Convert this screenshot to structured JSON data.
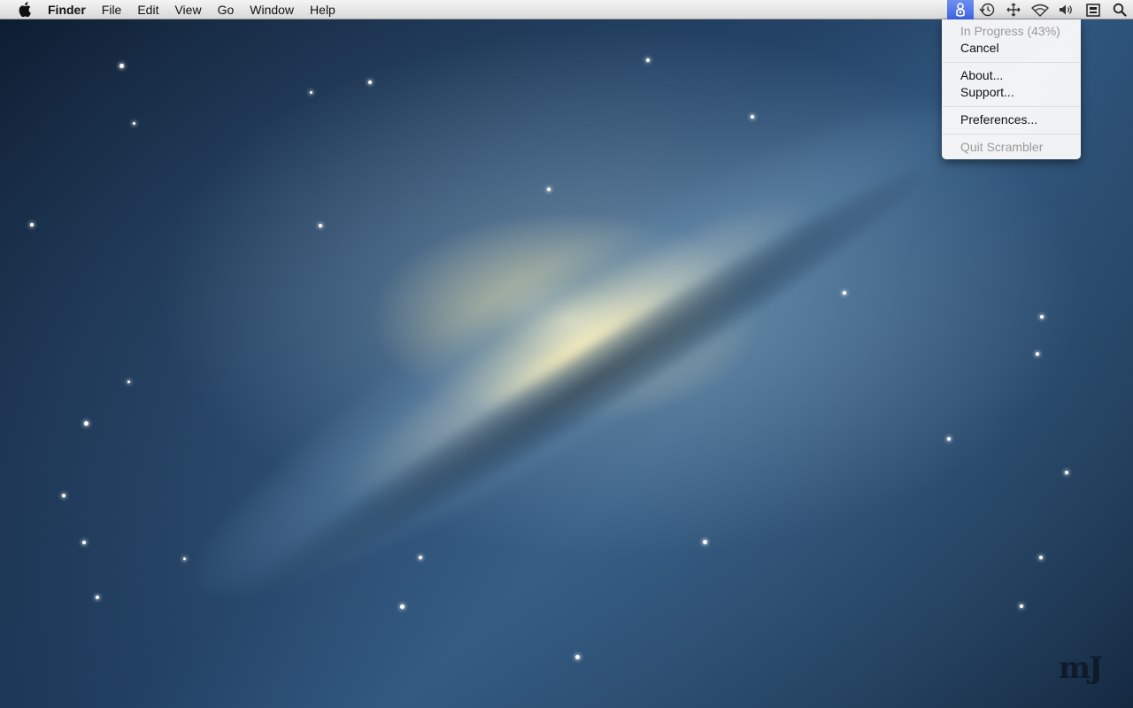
{
  "menubar": {
    "apple_icon": "apple-logo-icon",
    "items": [
      "Finder",
      "File",
      "Edit",
      "View",
      "Go",
      "Window",
      "Help"
    ],
    "status_icons": [
      "scrambler-icon",
      "time-machine-icon",
      "bluetooth-like-icon",
      "wifi-icon",
      "volume-icon",
      "input-menu-icon",
      "spotlight-icon"
    ]
  },
  "dropdown": {
    "status": "In Progress (43%)",
    "progress_percent": 43,
    "cancel": "Cancel",
    "about": "About...",
    "support": "Support...",
    "preferences": "Preferences...",
    "quit": "Quit Scrambler"
  },
  "watermark": "mJ",
  "colors": {
    "menubar_highlight": "#3f66e3",
    "disabled_text": "#9a9a9a"
  }
}
